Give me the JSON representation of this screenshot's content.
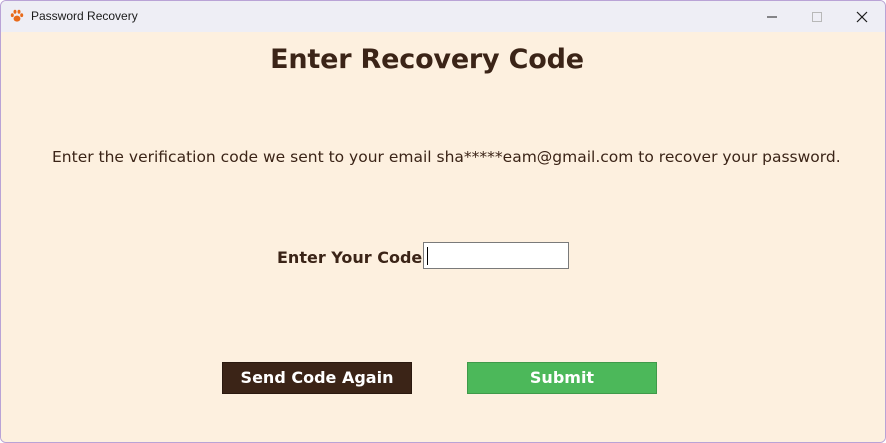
{
  "window": {
    "title": "Password Recovery",
    "icon": "paw-icon"
  },
  "titlebar_buttons": [
    "minimize-icon",
    "maximize-icon",
    "close-icon"
  ],
  "main": {
    "heading": "Enter Recovery Code",
    "instruction": "Enter the verification code we sent to your email sha*****eam@gmail.com to recover your password.",
    "code_label": "Enter Your Code",
    "code_value": "",
    "send_again_label": "Send Code Again",
    "submit_label": "Submit"
  },
  "colors": {
    "background": "#fdf0df",
    "text": "#3b2417",
    "send_button": "#3b2417",
    "submit_button": "#4cb85a",
    "icon": "#e86a1a"
  }
}
